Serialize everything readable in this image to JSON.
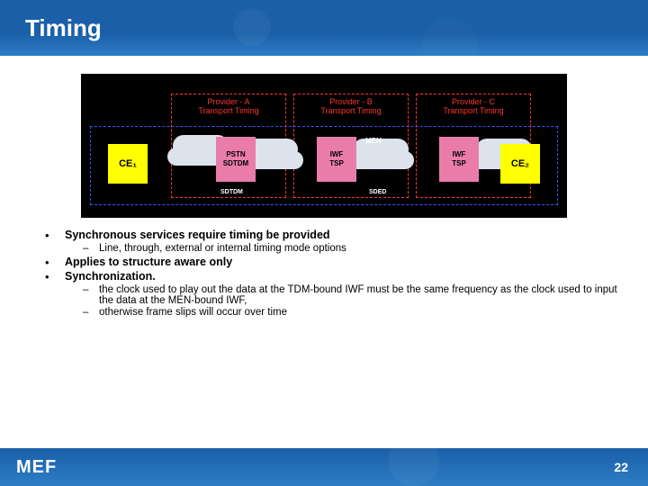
{
  "title": "Timing",
  "diagram": {
    "providers": [
      {
        "name": "Provider - A",
        "sub": "Transport Timing"
      },
      {
        "name": "Provider - B",
        "sub": "Transport Timing"
      },
      {
        "name": "Provider - C",
        "sub": "Transport Timing"
      }
    ],
    "ce1": "CE₁",
    "ce2": "CE₂",
    "pinkA_l1": "PSTN",
    "pinkA_l2": "SDTDM",
    "pinkB_l1": "IWF",
    "pinkB_l2": "TSP",
    "pinkB_l3": "MEN",
    "pinkC_l1": "IWF",
    "pinkC_l2": "TSP",
    "sdA": "SDTDM",
    "sdB": "SDED"
  },
  "bullets": {
    "b1": "Synchronous services require timing be provided",
    "b1_sub1": "Line, through, external or internal timing mode options",
    "b2": "Applies to structure aware only",
    "b3": "Synchronization.",
    "b3_sub1": "the clock used to play out the data at the TDM-bound IWF must be the same frequency as the clock used to input the data at the MEN-bound IWF,",
    "b3_sub2": "otherwise frame slips will occur over time"
  },
  "footer": {
    "logo": "MEF",
    "page": "22"
  }
}
